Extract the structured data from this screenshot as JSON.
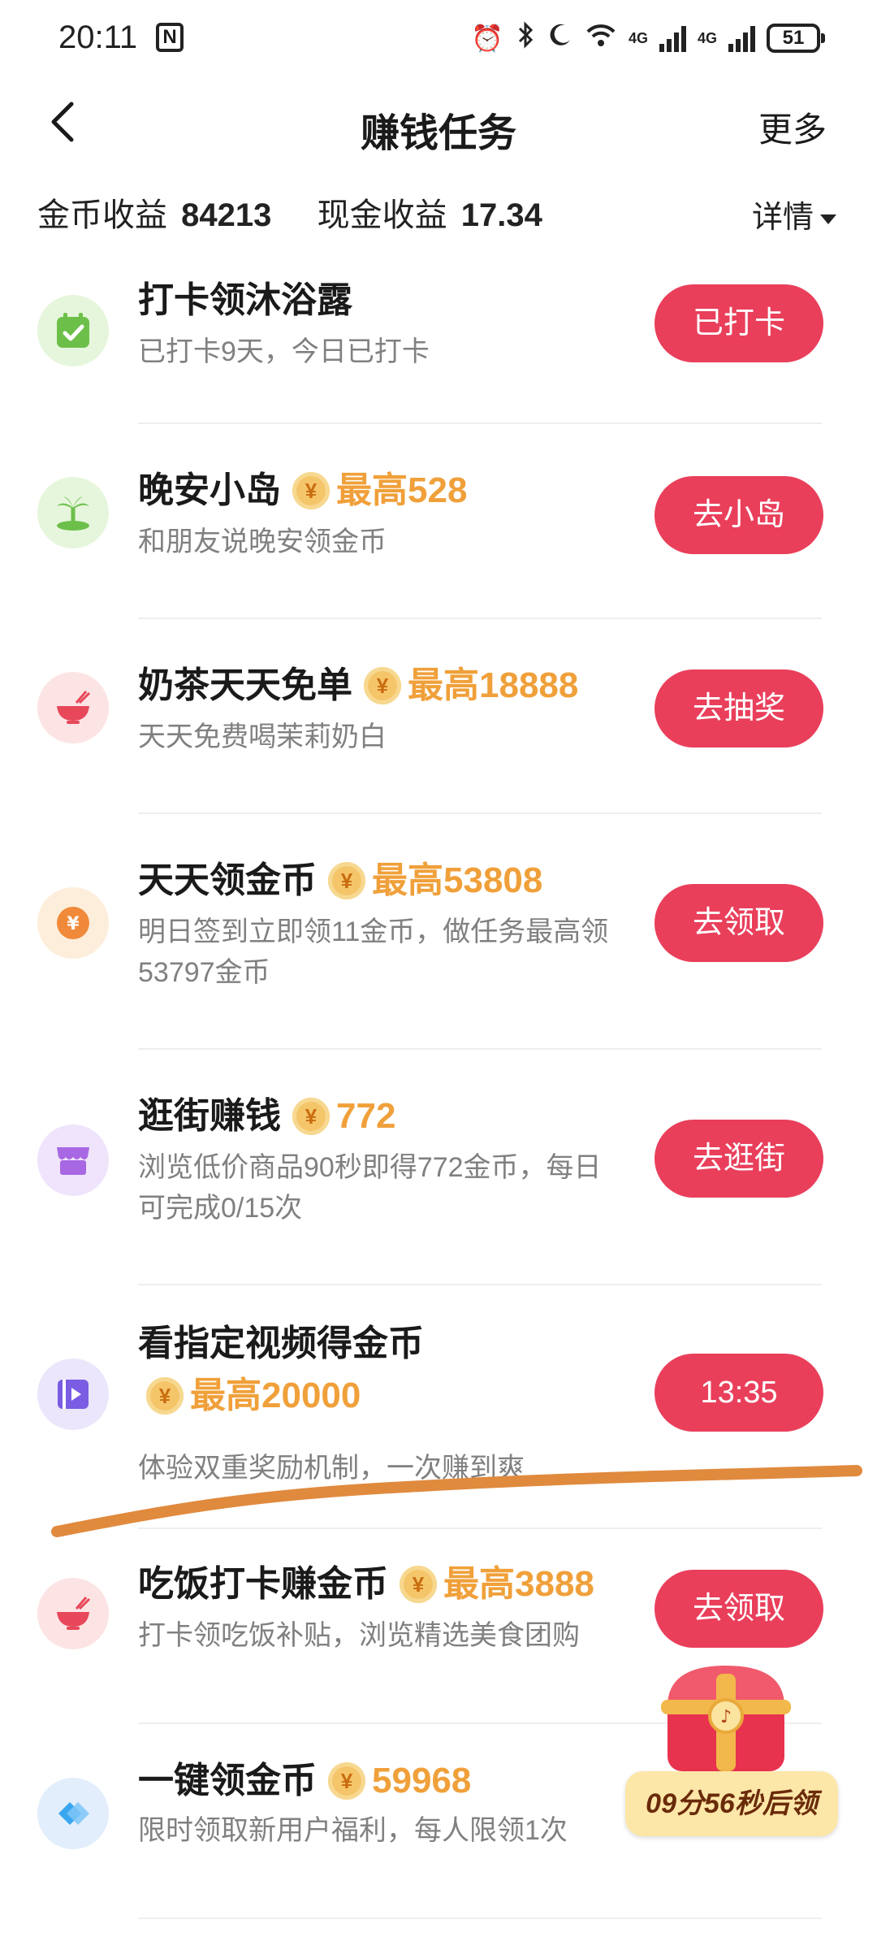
{
  "status_bar": {
    "time": "20:11",
    "battery": "51",
    "net1": "4G",
    "net2": "4G"
  },
  "header": {
    "title": "赚钱任务",
    "more": "更多"
  },
  "earnings": {
    "coin_label": "金币收益",
    "coin_value": "84213",
    "cash_label": "现金收益",
    "cash_value": "17.34",
    "detail": "详情"
  },
  "coin_symbol": "¥",
  "tasks": [
    {
      "title": "打卡领沐浴露",
      "reward": "",
      "desc": "已打卡9天，今日已打卡",
      "button": "已打卡",
      "icon": "checkin-icon",
      "icon_bg": "#e6f6dc"
    },
    {
      "title": "晚安小岛",
      "reward": "最高528",
      "desc": "和朋友说晚安领金币",
      "button": "去小岛",
      "icon": "island-icon",
      "icon_bg": "#e6f6dc"
    },
    {
      "title": "奶茶天天免单",
      "reward": "最高18888",
      "desc": "天天免费喝茉莉奶白",
      "button": "去抽奖",
      "icon": "bowl-icon",
      "icon_bg": "#fde4e4"
    },
    {
      "title": "天天领金币",
      "reward": "最高53808",
      "desc": "明日签到立即领11金币，做任务最高领53797金币",
      "button": "去领取",
      "icon": "coin-icon",
      "icon_bg": "#fdeedb"
    },
    {
      "title": "逛街赚钱",
      "reward": "772",
      "desc": "浏览低价商品90秒即得772金币，每日可完成0/15次",
      "button": "去逛街",
      "icon": "shop-icon",
      "icon_bg": "#efe4fb"
    },
    {
      "title": "看指定视频得金币",
      "reward": "最高20000",
      "desc": "体验双重奖励机制，一次赚到爽",
      "button": "13:35",
      "icon": "video-icon",
      "icon_bg": "#ebe6fb"
    },
    {
      "title": "吃饭打卡赚金币",
      "reward": "最高3888",
      "desc": "打卡领吃饭补贴，浏览精选美食团购",
      "button": "去领取",
      "icon": "bowl-icon",
      "icon_bg": "#fde4e4"
    },
    {
      "title": "一键领金币",
      "reward": "59968",
      "desc": "限时领取新用户福利，每人限领1次",
      "button": "",
      "icon": "diamond-icon",
      "icon_bg": "#e2eefc"
    }
  ],
  "floating_chest": {
    "label": "09分56秒后领"
  },
  "colors": {
    "accent": "#e93f5b",
    "reward": "#f0a03a",
    "annotation": "#e08a3e"
  }
}
